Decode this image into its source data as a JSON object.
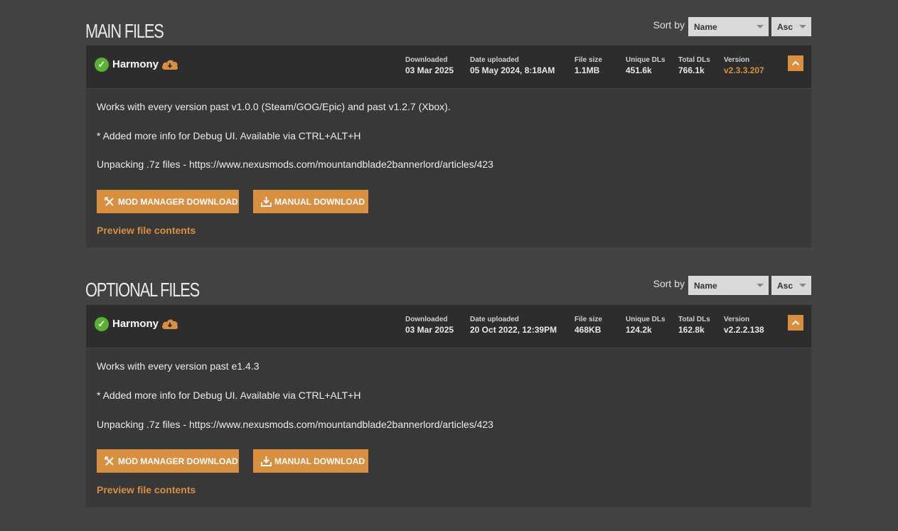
{
  "colors": {
    "accent": "#d98f40",
    "check": "#5ab034",
    "background": "#424242",
    "panel": "#383838",
    "header": "#2d2d2d"
  },
  "sections": [
    {
      "title": "MAIN FILES",
      "sort_label": "Sort by",
      "sort_field": "Name",
      "sort_dir": "Asc",
      "file": {
        "name": "Harmony",
        "stats": {
          "downloaded": {
            "label": "Downloaded",
            "value": "03 Mar 2025"
          },
          "uploaded": {
            "label": "Date uploaded",
            "value": "05 May 2024, 8:18AM"
          },
          "size": {
            "label": "File size",
            "value": "1.1MB"
          },
          "unique": {
            "label": "Unique DLs",
            "value": "451.6k"
          },
          "total": {
            "label": "Total DLs",
            "value": "766.1k"
          },
          "version": {
            "label": "Version",
            "value": "v2.3.3.207"
          }
        },
        "description": [
          "Works with every version past v1.0.0 (Steam/GOG/Epic) and past v1.2.7 (Xbox).",
          "* Added more info for Debug UI. Available via CTRL+ALT+H",
          "Unpacking .7z files - https://www.nexusmods.com/mountandblade2bannerlord/articles/423"
        ],
        "mod_manager_btn": "MOD MANAGER DOWNLOAD",
        "manual_btn": "MANUAL DOWNLOAD",
        "preview_link": "Preview file contents"
      }
    },
    {
      "title": "OPTIONAL FILES",
      "sort_label": "Sort by",
      "sort_field": "Name",
      "sort_dir": "Asc",
      "file": {
        "name": "Harmony",
        "stats": {
          "downloaded": {
            "label": "Downloaded",
            "value": "03 Mar 2025"
          },
          "uploaded": {
            "label": "Date uploaded",
            "value": "20 Oct 2022, 12:39PM"
          },
          "size": {
            "label": "File size",
            "value": "468KB"
          },
          "unique": {
            "label": "Unique DLs",
            "value": "124.2k"
          },
          "total": {
            "label": "Total DLs",
            "value": "162.8k"
          },
          "version": {
            "label": "Version",
            "value": "v2.2.2.138"
          }
        },
        "description": [
          "Works with every version past e1.4.3",
          "* Added more info for Debug UI. Available via CTRL+ALT+H",
          "Unpacking .7z files - https://www.nexusmods.com/mountandblade2bannerlord/articles/423"
        ],
        "mod_manager_btn": "MOD MANAGER DOWNLOAD",
        "manual_btn": "MANUAL DOWNLOAD",
        "preview_link": "Preview file contents"
      }
    }
  ]
}
